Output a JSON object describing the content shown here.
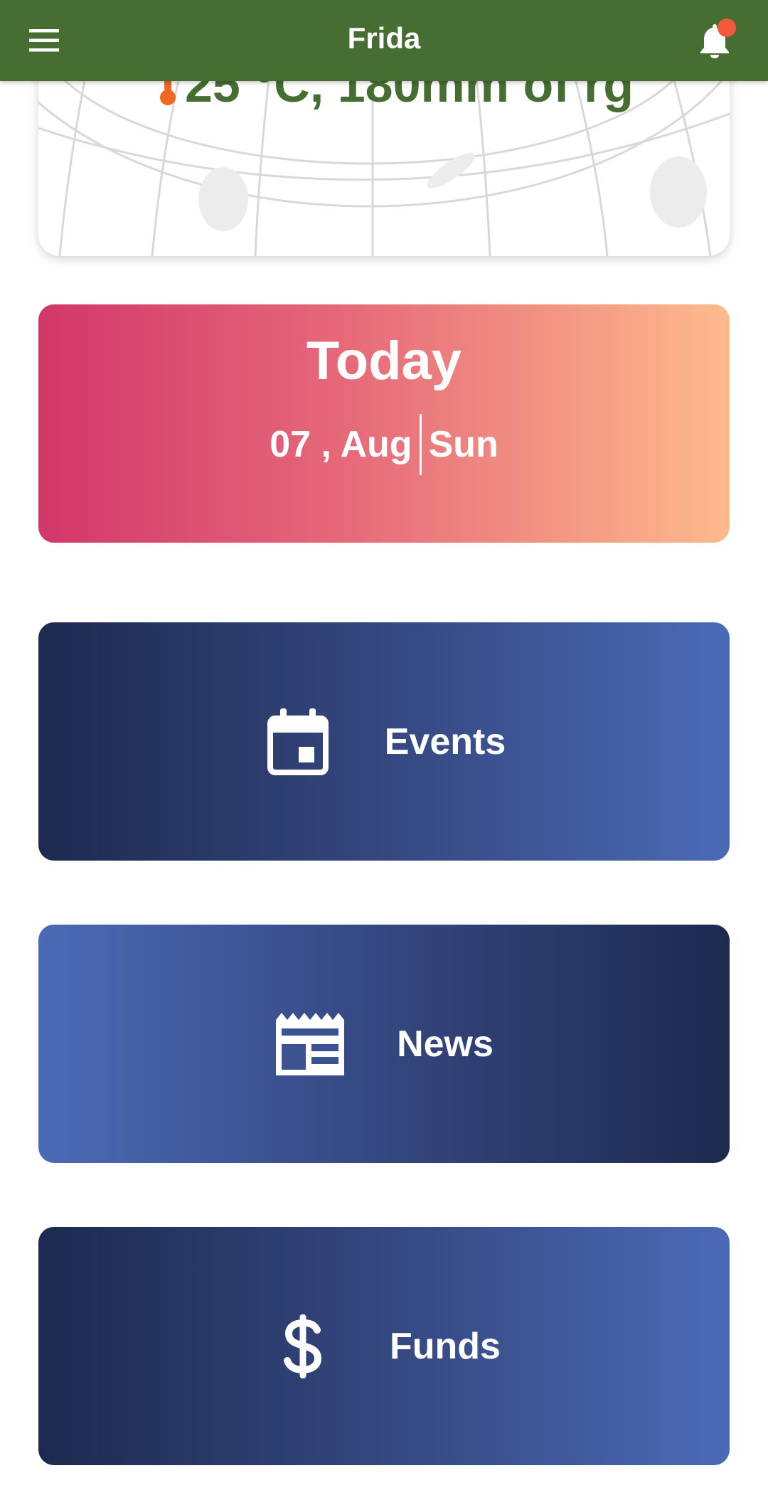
{
  "appbar": {
    "title": "Frida",
    "menu_icon": "menu-icon",
    "notification_icon": "bell-icon"
  },
  "weather": {
    "summary": "25 °C, 180mm of rg",
    "icon": "thermometer-icon"
  },
  "today": {
    "title": "Today",
    "date": "07 , Aug",
    "weekday": "Sun"
  },
  "features": {
    "events": {
      "label": "Events",
      "icon": "calendar-icon"
    },
    "news": {
      "label": "News",
      "icon": "newspaper-icon"
    },
    "funds": {
      "label": "Funds",
      "icon": "dollar-icon"
    }
  },
  "colors": {
    "brand_green": "#466d32",
    "notification_dot": "#f05a3a",
    "thermometer": "#f26522",
    "today_gradient": [
      "#d2376a",
      "#fdbb8d"
    ],
    "feature_gradient": [
      "#1d2a4f",
      "#4b6ab6"
    ]
  }
}
